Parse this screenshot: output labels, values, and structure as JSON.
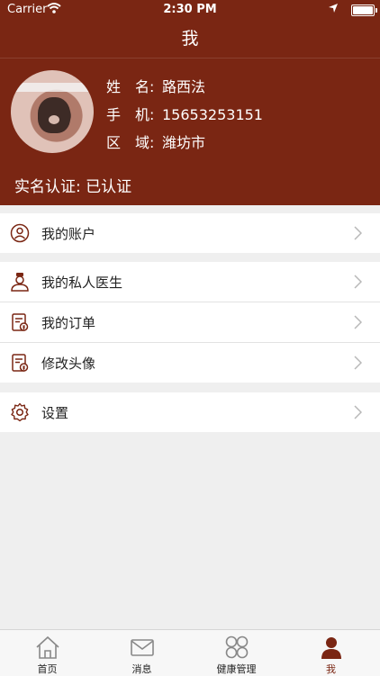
{
  "status_bar": {
    "carrier": "Carrier",
    "time": "2:30 PM"
  },
  "nav": {
    "title": "我"
  },
  "profile": {
    "name_label": "姓　名:",
    "name": "路西法",
    "phone_label": "手　机:",
    "phone": "15653253151",
    "region_label": "区　域:",
    "region": "潍坊市",
    "verify_label": "实名认证:",
    "verify_value": "已认证"
  },
  "menu": {
    "account": "我的账户",
    "private_doctor": "我的私人医生",
    "orders": "我的订单",
    "change_avatar": "修改头像",
    "settings": "设置"
  },
  "tabbar": {
    "home": "首页",
    "messages": "消息",
    "health": "健康管理",
    "me": "我"
  },
  "colors": {
    "brand": "#7a2613",
    "icon": "#7a2613",
    "background": "#efefef"
  }
}
